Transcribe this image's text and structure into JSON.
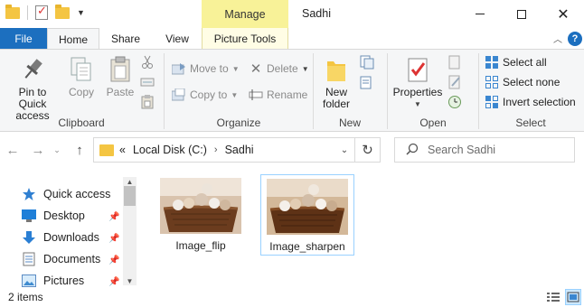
{
  "window": {
    "title": "Sadhi",
    "context_tab": "Manage",
    "controls": {
      "minimize": "minimize-icon",
      "maximize": "maximize-icon",
      "close": "close-icon"
    }
  },
  "ribbon_tabs": {
    "file": "File",
    "home": "Home",
    "share": "Share",
    "view": "View",
    "picture_tools": "Picture Tools",
    "help": "?"
  },
  "ribbon": {
    "clipboard": {
      "label": "Clipboard",
      "pin": "Pin to Quick access",
      "copy": "Copy",
      "paste": "Paste"
    },
    "organize": {
      "label": "Organize",
      "move_to": "Move to",
      "copy_to": "Copy to",
      "delete": "Delete",
      "rename": "Rename"
    },
    "new": {
      "label": "New",
      "new_folder": "New folder"
    },
    "open": {
      "label": "Open",
      "properties": "Properties"
    },
    "select": {
      "label": "Select",
      "select_all": "Select all",
      "select_none": "Select none",
      "invert": "Invert selection"
    }
  },
  "address": {
    "overflow": "«",
    "crumbs": [
      "Local Disk (C:)",
      "Sadhi"
    ],
    "search_placeholder": "Search Sadhi"
  },
  "nav_pane": {
    "items": [
      {
        "label": "Quick access",
        "icon": "star-icon",
        "pinned": false
      },
      {
        "label": "Desktop",
        "icon": "desktop-icon",
        "pinned": true
      },
      {
        "label": "Downloads",
        "icon": "download-icon",
        "pinned": true
      },
      {
        "label": "Documents",
        "icon": "documents-icon",
        "pinned": true
      },
      {
        "label": "Pictures",
        "icon": "pictures-icon",
        "pinned": true
      }
    ]
  },
  "files": [
    {
      "name": "Image_flip",
      "selected": false
    },
    {
      "name": "Image_sharpen",
      "selected": true
    }
  ],
  "status": {
    "item_count": "2 items"
  },
  "colors": {
    "accent": "#1c6fbf",
    "manage_tab": "#f8f298",
    "selection_border": "#99d1ff"
  }
}
